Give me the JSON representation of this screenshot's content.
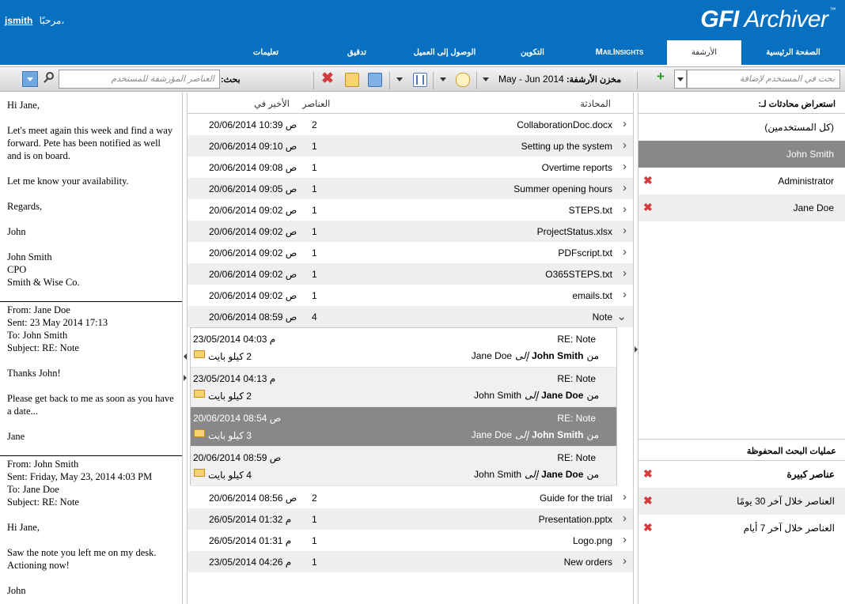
{
  "header": {
    "username": "jsmith",
    "greeting": "مرحبًا،",
    "logo_brand": "GFI",
    "logo_product": "Archiver",
    "logo_tm": "™",
    "tabs": [
      "الصفحة الرئيسية",
      "الأرشفة",
      "MailInsights",
      "التكوين",
      "الوصول إلى العميل",
      "تدقيق",
      "تعليمات"
    ],
    "active_tab": "الأرشفة"
  },
  "toolbar": {
    "user_search_placeholder": "بحث في المستخدم لإضافة",
    "archive_store_label": "مخزن الأرشفة:",
    "archive_store_value": "May - Jun 2014",
    "search_label": "بحث:",
    "search_placeholder": "العناصر المؤرشفة للمستخدم"
  },
  "email_preview": {
    "blocks": [
      [
        "Hi Jane,",
        "Let's meet again this week and find a way forward. Pete has been notified as well and is on board.",
        "Let me know your availability.",
        "Regards,",
        "John",
        "John Smith\nCPO\nSmith & Wise Co."
      ],
      [
        "From: Jane Doe\nSent: 23 May 2014 17:13\nTo: John Smith\nSubject: RE: Note",
        "Thanks John!",
        "Please get back to me as soon as you have a date...",
        "Jane"
      ],
      [
        "From: John Smith\nSent: Friday, May 23, 2014 4:03 PM\nTo: Jane Doe\nSubject: RE: Note",
        "Hi Jane,",
        "Saw the note you left me on my desk. Actioning now!",
        "John"
      ]
    ]
  },
  "conversations": {
    "headers": {
      "conversation": "المحادثة",
      "items": "العناصر",
      "latest": "الأخير في"
    },
    "rows_top": [
      {
        "subject": "CollaborationDoc.docx",
        "count": "2",
        "date": "20/06/2014 10:39 ص"
      },
      {
        "subject": "Setting up the system",
        "count": "1",
        "date": "20/06/2014 09:10 ص"
      },
      {
        "subject": "Overtime reports",
        "count": "1",
        "date": "20/06/2014 09:08 ص"
      },
      {
        "subject": "Summer opening hours",
        "count": "1",
        "date": "20/06/2014 09:05 ص"
      },
      {
        "subject": "STEPS.txt",
        "count": "1",
        "date": "20/06/2014 09:02 ص"
      },
      {
        "subject": "ProjectStatus.xlsx",
        "count": "1",
        "date": "20/06/2014 09:02 ص"
      },
      {
        "subject": "PDFscript.txt",
        "count": "1",
        "date": "20/06/2014 09:02 ص"
      },
      {
        "subject": "O365STEPS.txt",
        "count": "1",
        "date": "20/06/2014 09:02 ص"
      },
      {
        "subject": "emails.txt",
        "count": "1",
        "date": "20/06/2014 09:02 ص"
      },
      {
        "subject": "Note",
        "count": "4",
        "date": "20/06/2014 08:59 ص"
      }
    ],
    "thread": [
      {
        "subject": "RE: Note",
        "date": "23/05/2014 04:03 م",
        "from_prefix": "من",
        "from": "John Smith",
        "to_prefix": "إلى",
        "to": "Jane Doe",
        "size": "2 كيلو بايت"
      },
      {
        "subject": "RE: Note",
        "date": "23/05/2014 04:13 م",
        "from_prefix": "من",
        "from": "Jane Doe",
        "to_prefix": "إلى",
        "to": "John Smith",
        "size": "2 كيلو بايت"
      },
      {
        "subject": "RE: Note",
        "date": "20/06/2014 08:54 ص",
        "from_prefix": "من",
        "from": "John Smith",
        "to_prefix": "إلى",
        "to": "Jane Doe",
        "size": "3 كيلو بايت"
      },
      {
        "subject": "RE: Note",
        "date": "20/06/2014 08:59 ص",
        "from_prefix": "من",
        "from": "Jane Doe",
        "to_prefix": "إلى",
        "to": "John Smith",
        "size": "4 كيلو بايت"
      }
    ],
    "selected_thread_index": 2,
    "rows_bottom": [
      {
        "subject": "Guide for the trial",
        "count": "2",
        "date": "20/06/2014 08:56 ص"
      },
      {
        "subject": "Presentation.pptx",
        "count": "1",
        "date": "26/05/2014 01:32 م"
      },
      {
        "subject": "Logo.png",
        "count": "1",
        "date": "26/05/2014 01:31 م"
      },
      {
        "subject": "New orders",
        "count": "1",
        "date": "23/05/2014 04:26 م"
      }
    ]
  },
  "users_panel": {
    "title": "استعراض محادثات لـ:",
    "items": [
      "(كل المستخدمين)",
      "John Smith",
      "Administrator",
      "Jane Doe"
    ],
    "selected": "John Smith"
  },
  "saved_searches": {
    "title": "عمليات البحث المحفوظة",
    "items": [
      "عناصر كبيرة",
      "العناصر خلال آخر 30 يومًا",
      "العناصر خلال آخر 7 أيام"
    ]
  },
  "icons": [
    "search-icon",
    "close-icon",
    "add-icon",
    "chevron-down-icon",
    "chevron-right-icon",
    "envelope-icon",
    "contact-icon",
    "columns-icon",
    "comment-icon"
  ]
}
